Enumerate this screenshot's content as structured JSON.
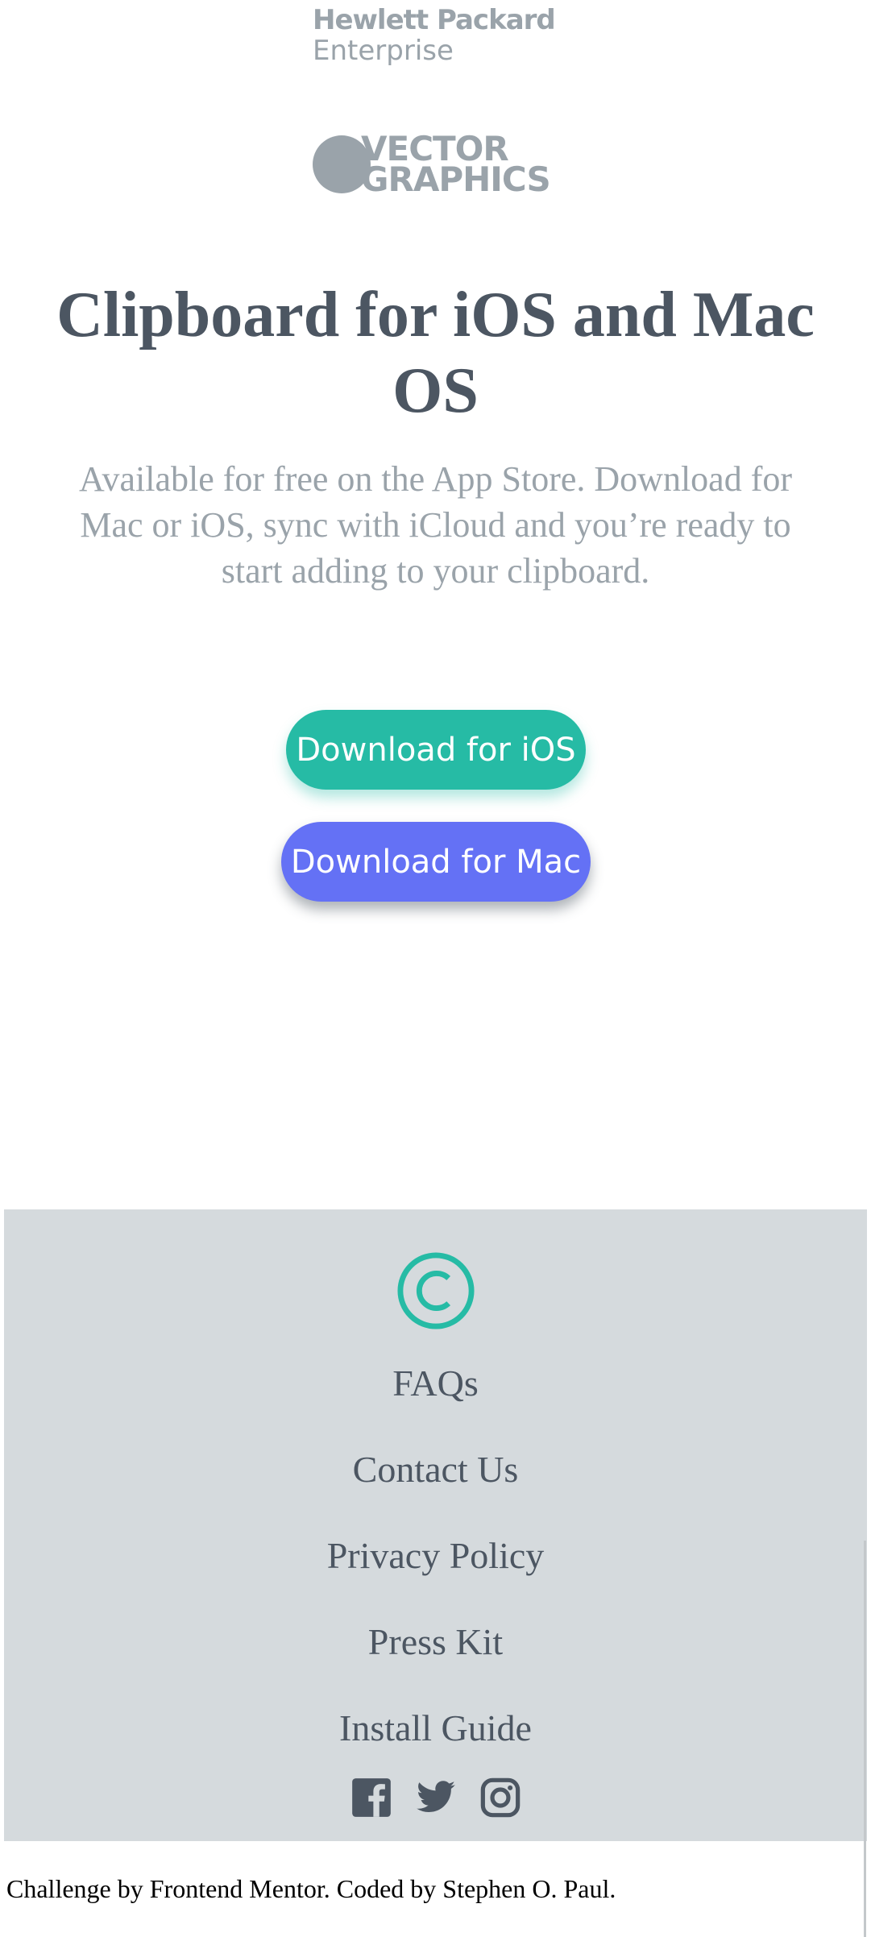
{
  "logos": {
    "hpe_line1": "Hewlett Packard",
    "hpe_line2": "Enterprise",
    "vg_line1": "VECTOR",
    "vg_line2": "GRAPHICS"
  },
  "hero": {
    "title": "Clipboard for iOS and Mac OS",
    "subtitle": "Available for free on the App Store. Download for Mac or iOS, sync with iCloud and you’re ready to start adding to your clipboard."
  },
  "buttons": {
    "ios_label": "Download for iOS",
    "mac_label": "Download for Mac"
  },
  "footer": {
    "links": [
      "FAQs",
      "Contact Us",
      "Privacy Policy",
      "Press Kit",
      "Install Guide"
    ],
    "social_icons": [
      "facebook-icon",
      "twitter-icon",
      "instagram-icon"
    ]
  },
  "credit": "Challenge by Frontend Mentor. Coded by Stephen O. Paul.",
  "colors": {
    "accent_green": "#26bba5",
    "accent_blue": "#6471f5",
    "heading": "#4c5662",
    "muted": "#9aa3aa",
    "footer_bg": "#d5dadd"
  }
}
